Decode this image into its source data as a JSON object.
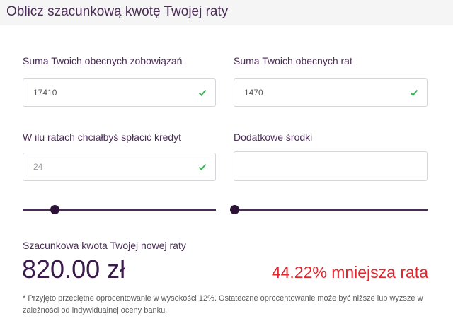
{
  "header": {
    "title": "Oblicz szacunkową kwotę Twojej raty"
  },
  "form": {
    "total_obligations": {
      "label": "Suma Twoich obecnych zobowiązań",
      "value": "17410",
      "valid": true
    },
    "total_installments": {
      "label": "Suma Twoich obecnych rat",
      "value": "1470",
      "valid": true
    },
    "installments_count": {
      "label": "W ilu ratach chciałbyś spłacić kredyt",
      "value": "24",
      "valid": true
    },
    "additional_funds": {
      "label": "Dodatkowe środki",
      "value": "",
      "valid": false
    }
  },
  "sliders": {
    "installments_slider_level": 0.15,
    "funds_slider_level": 0.0
  },
  "result": {
    "label": "Szacunkowa kwota Twojej nowej raty",
    "amount": "820.00 zł",
    "reduction": "44.22% mniejsza rata"
  },
  "footnote": "* Przyjęto przeciętne oprocentowanie w wysokości 12%. Ostateczne oprocentowanie może być niższe lub wyższe w zależności od indywidualnej oceny banku.",
  "colors": {
    "heading": "#4a2c55",
    "accent_dark": "#2b1236",
    "check_green": "#3cb55a",
    "reduction_red": "#e3262e"
  },
  "icons": {
    "valid": "check-icon"
  }
}
